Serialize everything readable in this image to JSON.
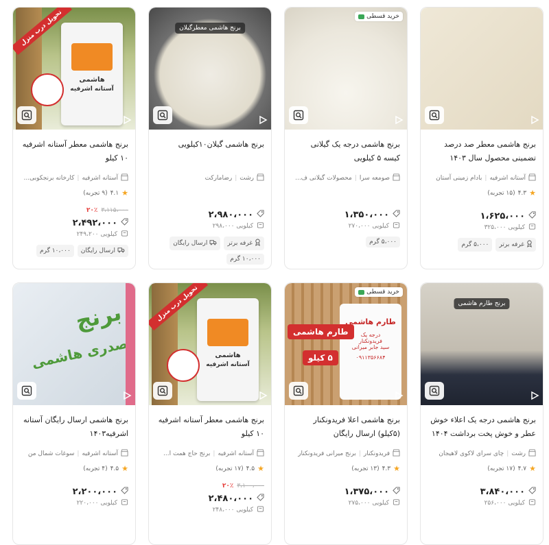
{
  "products": [
    {
      "title": "برنج هاشمی معطر آستانه اشرفیه ۱۰ کیلو",
      "shop": [
        "آستانه اشرفیه",
        "کارخانه برنجکوبی..."
      ],
      "rating": "۴.۱",
      "reviews": "(۹ تجربه)",
      "old_price": "۳،۱۱۵،۰۰۰",
      "discount": "۲۰٪",
      "price": "۲،۴۹۲،۰۰۰",
      "unit_price": "کیلویی ۲۴۹،۲۰۰",
      "tags": [
        "ارسال رایگان",
        "۱۰،۰۰۰ گرم"
      ],
      "image": "bag1",
      "badge": "",
      "bag_text": [
        "هاشمی",
        "آستانه اشرفیه"
      ],
      "stamp": "تحویل درب منزل"
    },
    {
      "title": "برنج هاشمی گیلان۱۰کیلویی",
      "shop": [
        "رشت",
        "رضامارکت"
      ],
      "rating": "",
      "reviews": "",
      "old_price": "",
      "discount": "",
      "price": "۲،۹۸۰،۰۰۰",
      "unit_price": "کیلویی ۲۹۸،۰۰۰",
      "tags": [
        "غرفه برتر",
        "ارسال رایگان",
        "۱۰،۰۰۰ گرم"
      ],
      "image": "rice-bowl",
      "badge": "",
      "overlay": "برنج هاشمی معطرگیلان"
    },
    {
      "title": "برنج هاشمی درجه یک گیلانی کیسه ۵ کیلویی",
      "shop": [
        "صومعه سرا",
        "محصولات گیلانی ف..."
      ],
      "rating": "",
      "reviews": "",
      "old_price": "",
      "discount": "",
      "price": "۱،۳۵۰،۰۰۰",
      "unit_price": "کیلویی ۲۷۰،۰۰۰",
      "tags": [
        "۵،۰۰۰ گرم"
      ],
      "image": "rice-pile",
      "badge": "خرید قسطی"
    },
    {
      "title": "برنج هاشمی معطر صد درصد تضمینی محصول سال ۱۴۰۳",
      "shop": [
        "آستانه اشرفیه",
        "بادام زمینی آستان"
      ],
      "rating": "۴.۳",
      "reviews": "(۱۵ تجربه)",
      "old_price": "",
      "discount": "",
      "price": "۱،۶۲۵،۰۰۰",
      "unit_price": "کیلویی ۳۲۵،۰۰۰",
      "tags": [
        "غرفه برتر",
        "۵،۰۰۰ گرم"
      ],
      "image": "rice-close",
      "badge": ""
    },
    {
      "title": "برنج هاشمی ارسال رایگان آستانه اشرفیه۱۴۰۳",
      "shop": [
        "آستانه اشرفیه",
        "سوغات شمال من"
      ],
      "rating": "۴.۵",
      "reviews": "(۴ تجربه)",
      "old_price": "",
      "discount": "",
      "price": "۲،۲۰۰،۰۰۰",
      "unit_price": "کیلویی ۲۲۰،۰۰۰",
      "tags": [],
      "image": "sack",
      "badge": "",
      "sack_text": [
        "برنج",
        "صدری هاشمی"
      ]
    },
    {
      "title": "برنج هاشمی معطر آستانه اشرفیه ۱۰ کیلو",
      "shop": [
        "آستانه اشرفیه",
        "برنج حاج همت ا..."
      ],
      "rating": "۴.۵",
      "reviews": "(۱۷ تجربه)",
      "old_price": "۳،۱۰۰،۰۰۰",
      "discount": "۲۰٪",
      "price": "۲،۴۸۰،۰۰۰",
      "unit_price": "کیلویی ۲۴۸،۰۰۰",
      "tags": [],
      "image": "bag1",
      "badge": "",
      "bag_text": [
        "هاشمی",
        "آستانه اشرفیه"
      ],
      "stamp": "تحویل درب منزل"
    },
    {
      "title": "برنج هاشمی اعلا فریدونکنار (۵کیلو) ارسال رایگان",
      "shop": [
        "فریدونکنار",
        "برنج میرانی فریدونکنار"
      ],
      "rating": "۴.۳",
      "reviews": "(۱۳ تجربه)",
      "old_price": "",
      "discount": "",
      "price": "۱،۳۷۵،۰۰۰",
      "unit_price": "کیلویی ۲۷۵،۰۰۰",
      "tags": [],
      "image": "bag2",
      "badge": "خرید قسطی",
      "promo": [
        "طارم هاشمی",
        "۵ کیلو"
      ],
      "bag_text": [
        "طارم هاشمی",
        "درجه یک",
        "فریدونکنار",
        "سید جابر میرانی",
        "۰۹۱۱۳۵۶۶۸۴"
      ]
    },
    {
      "title": "برنج هاشمی درجه یک اعلاء خوش عطر و خوش پخت برداشت ۱۴۰۴ (...",
      "shop": [
        "رشت",
        "چای سرای لاکوی لاهیجان"
      ],
      "rating": "۴.۷",
      "reviews": "(۱۷ تجربه)",
      "old_price": "",
      "discount": "",
      "price": "۳،۸۴۰،۰۰۰",
      "unit_price": "کیلویی ۲۵۶،۰۰۰",
      "tags": [],
      "image": "rice-dark",
      "badge": "",
      "overlay": "برنج طارم هاشمی"
    }
  ],
  "colors": {
    "discount": "#e53935",
    "star": "#f5a623",
    "badge_dot": "#3aa757"
  },
  "icons": {
    "zoom": "image-search-icon",
    "play": "play-icon",
    "shop": "store-icon",
    "price": "price-tag-icon",
    "unit": "scale-icon",
    "star": "star-icon",
    "tag_free": "truck-icon",
    "tag_top": "medal-icon",
    "tag_weight": "weight-icon"
  }
}
